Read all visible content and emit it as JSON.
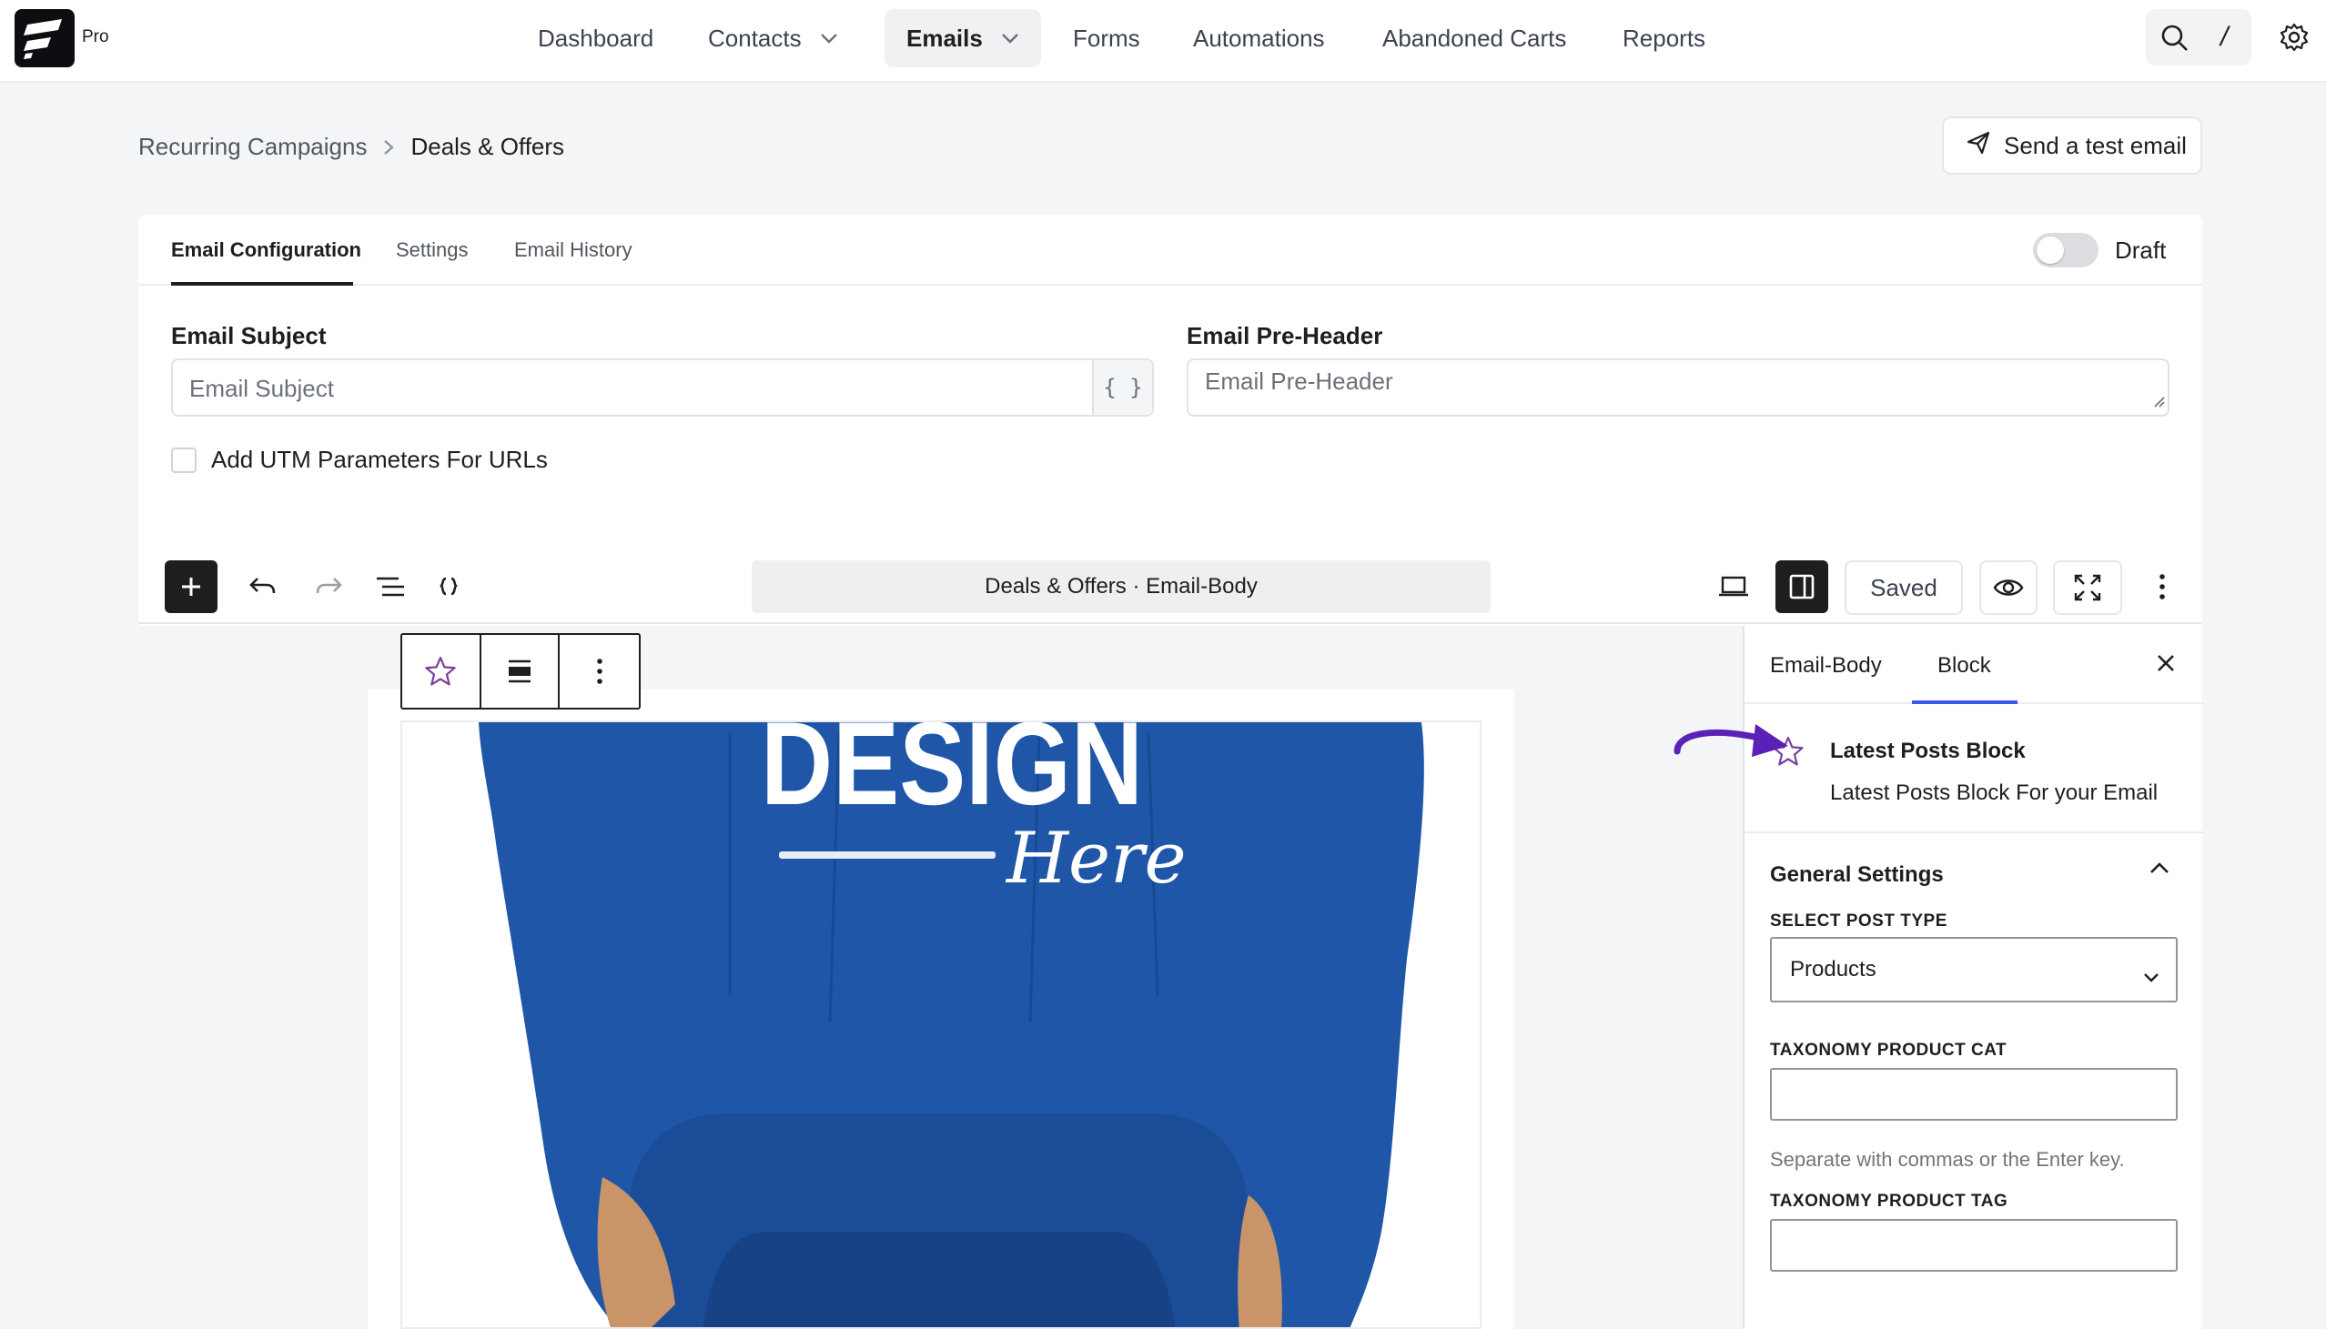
{
  "brand": {
    "badge": "Pro"
  },
  "nav": {
    "dashboard": "Dashboard",
    "contacts": "Contacts",
    "emails": "Emails",
    "forms": "Forms",
    "automations": "Automations",
    "abandoned_carts": "Abandoned Carts",
    "reports": "Reports",
    "shortcut_key": "/"
  },
  "breadcrumb": {
    "parent": "Recurring Campaigns",
    "current": "Deals & Offers"
  },
  "header": {
    "send_test_label": "Send a test email"
  },
  "tabs": {
    "config": "Email Configuration",
    "settings": "Settings",
    "history": "Email History"
  },
  "status": {
    "label": "Draft",
    "enabled": false
  },
  "form": {
    "subject_label": "Email Subject",
    "subject_placeholder": "Email Subject",
    "smartcode_label": "{ }",
    "preheader_label": "Email Pre-Header",
    "preheader_placeholder": "Email Pre-Header",
    "utm_label": "Add UTM Parameters For URLs"
  },
  "editor": {
    "document_title": "Deals & Offers · Email-Body",
    "saved_label": "Saved"
  },
  "sidebar": {
    "tab_email_body": "Email-Body",
    "tab_block": "Block",
    "block_name": "Latest Posts Block",
    "block_description": "Latest Posts Block For your Email",
    "general_settings": "General Settings",
    "post_type_label": "SELECT POST TYPE",
    "post_type_value": "Products",
    "taxonomy_cat_label": "TAXONOMY PRODUCT CAT",
    "taxonomy_cat_help": "Separate with commas or the Enter key.",
    "taxonomy_tag_label": "TAXONOMY PRODUCT TAG"
  },
  "colors": {
    "accent_blue": "#3858e9",
    "block_icon_purple": "#7a3fa0",
    "annotation_arrow": "#5b21b6",
    "hoodie_blue": "#1f56a8"
  }
}
